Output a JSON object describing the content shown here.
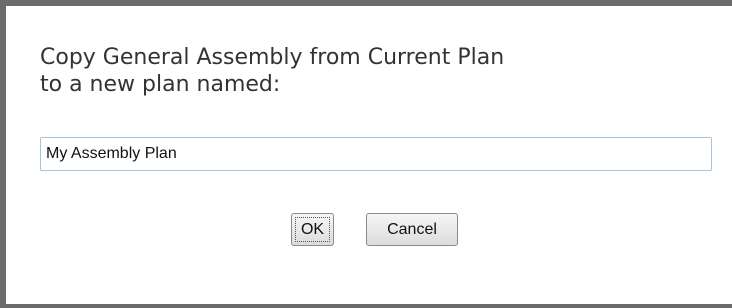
{
  "dialog": {
    "prompt_line1": "Copy General Assembly from Current Plan",
    "prompt_line2": "to a new plan named:",
    "plan_name_value": "My Assembly Plan",
    "ok_label": "OK",
    "cancel_label": "Cancel"
  }
}
